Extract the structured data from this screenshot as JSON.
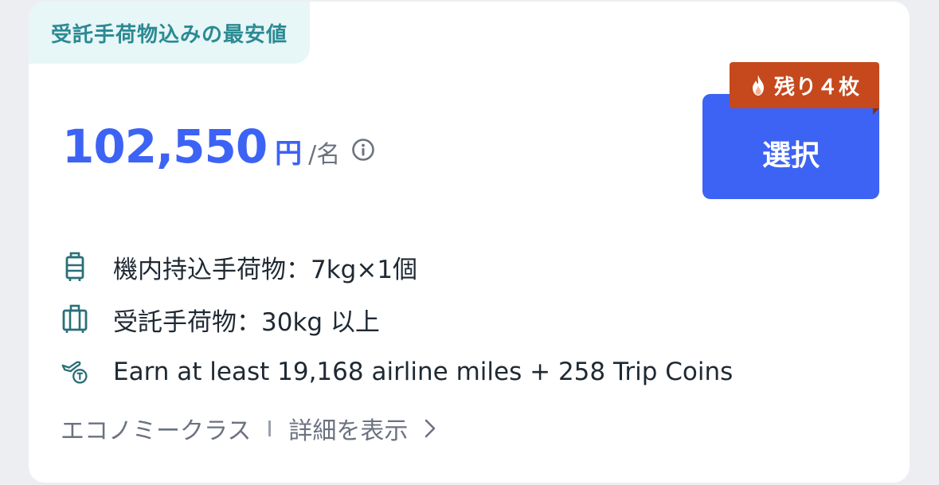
{
  "tag": {
    "label": "受託手荷物込みの最安値"
  },
  "price": {
    "amount": "102,550",
    "unit": "円",
    "per": "/名"
  },
  "select_button": {
    "label": "選択"
  },
  "badge": {
    "label": "残り４枚"
  },
  "features": [
    {
      "icon": "carry-on-bag-icon",
      "text": "機内持込手荷物：7kg×1個"
    },
    {
      "icon": "checked-bag-icon",
      "text": "受託手荷物：30kg 以上"
    },
    {
      "icon": "miles-plane-icon",
      "text": "Earn at least 19,168 airline miles + 258 Trip Coins"
    }
  ],
  "footer": {
    "cabin": "エコノミークラス",
    "details_label": "詳細を表示"
  },
  "colors": {
    "accent": "#3d63f4",
    "badge": "#c5491c",
    "tag_bg": "#e7f6f7",
    "tag_text": "#2b8a93",
    "icon": "#2b6f78"
  }
}
